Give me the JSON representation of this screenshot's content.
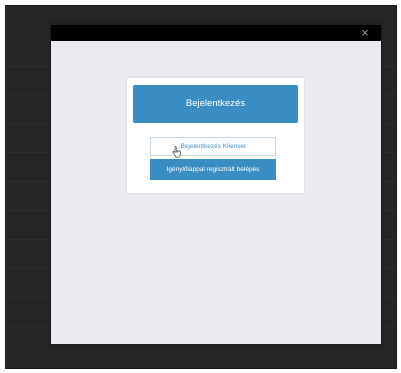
{
  "modal": {
    "close_icon": "×"
  },
  "login": {
    "title": "Bejelentkezés",
    "client_gate_button": "Bejelentkezés Kliensel",
    "registered_button": "Igénylőlappal regisztrált belépés"
  },
  "icons": {
    "close": "close-icon",
    "cursor": "hand-cursor-icon"
  },
  "colors": {
    "accent": "#3a8dc2",
    "backdrop": "#262626",
    "modal_bg": "#e8eaee",
    "header_bar": "#000000"
  }
}
